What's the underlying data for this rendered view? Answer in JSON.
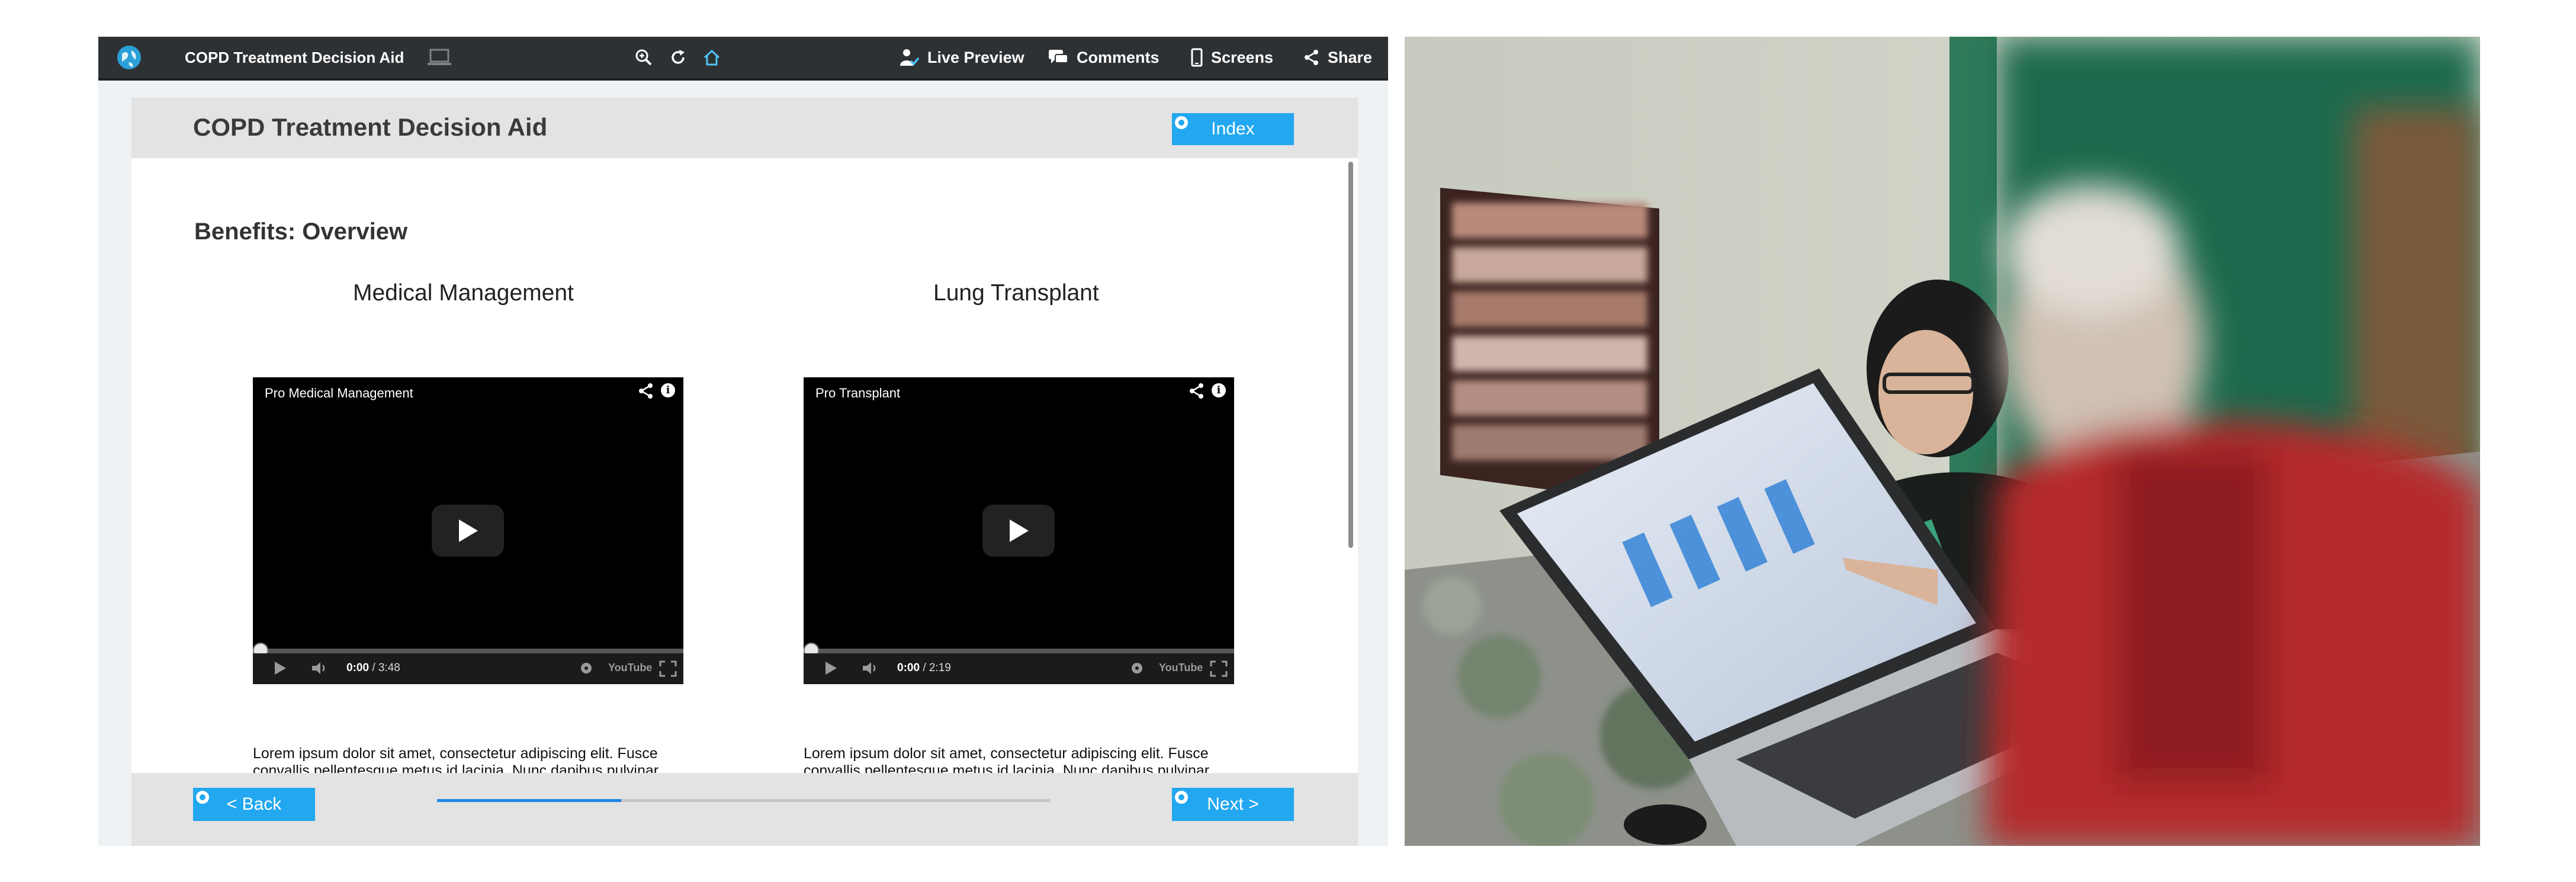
{
  "toolbar": {
    "title": "COPD Treatment Decision Aid",
    "live_preview": "Live Preview",
    "comments": "Comments",
    "screens": "Screens",
    "share": "Share"
  },
  "screen": {
    "app_title": "COPD Treatment Decision Aid",
    "index_button": "Index",
    "section_title": "Benefits: Overview",
    "back_button": "< Back",
    "next_button": "Next >",
    "page_progress": 0.3
  },
  "options": [
    {
      "title": "Medical Management",
      "video_title": "Pro Medical Management",
      "time_current": "0:00",
      "time_total": "/ 3:48",
      "description": "Lorem ipsum dolor sit amet, consectetur adipiscing elit. Fusce convallis pellentesque metus id lacinia. Nunc dapibus pulvinar auctor. Duis nec sem at orci commodo viverra id in ipsum."
    },
    {
      "title": "Lung Transplant",
      "video_title": "Pro Transplant",
      "time_current": "0:00",
      "time_total": "/ 2:19",
      "description": "Lorem ipsum dolor sit amet, consectetur adipiscing elit. Fusce convallis pellentesque metus id lacinia. Nunc dapibus pulvinar auctor. Duis nec sem at orci commodo viverra id in ipsum."
    }
  ],
  "video_player": {
    "logo_text": "YouTube"
  },
  "icons": {
    "toolbar": [
      "globe-logo-icon",
      "laptop-icon",
      "zoom-in-icon",
      "refresh-icon",
      "home-icon",
      "person-check-icon",
      "comment-bubbles-icon",
      "phone-screen-icon",
      "share-icon"
    ],
    "video": [
      "share-icon",
      "info-icon",
      "play-icon",
      "volume-icon",
      "settings-icon",
      "fullscreen-icon"
    ]
  },
  "colors": {
    "toolbar_bg": "#2e3134",
    "accent_button": "#22a7f0",
    "progress_fill": "#1e88e5",
    "header_bar": "#e3e3e3",
    "home_icon": "#4fc3f7"
  }
}
